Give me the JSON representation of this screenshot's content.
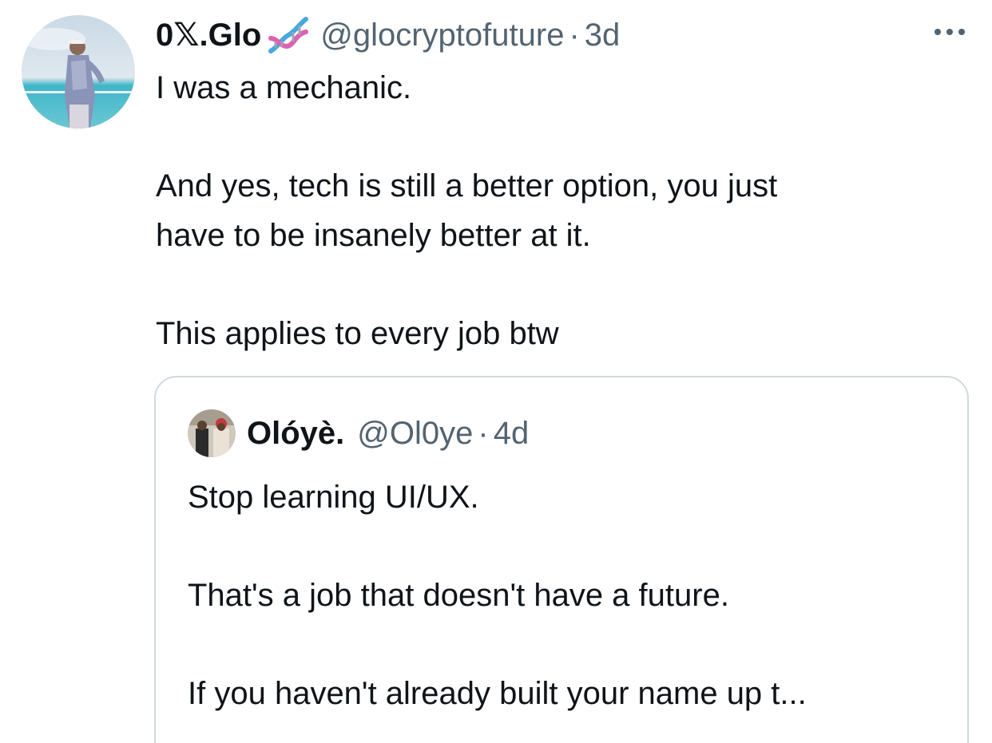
{
  "tweet": {
    "display_name": "0𝕏.Glo",
    "badge_icon": "dna-icon",
    "handle": "@glocryptofuture",
    "separator": "·",
    "time": "3d",
    "more_icon": "more-horizontal-icon",
    "text": "I was a mechanic.\n\nAnd yes, tech is still a better option, you just\nhave to be insanely better at it.\n\nThis applies to every job btw"
  },
  "quoted_tweet": {
    "display_name": "Olóyè.",
    "handle": "@Ol0ye",
    "separator": "·",
    "time": "4d",
    "text": "Stop learning UI/UX.\n\nThat's a job that doesn't have a future.\n\nIf you haven't already built your name up t..."
  },
  "colors": {
    "text_primary": "#0f1419",
    "text_secondary": "#536471",
    "border": "#cfd9de",
    "dna_pink": "#e05fb0",
    "dna_blue": "#4aa7e0"
  }
}
